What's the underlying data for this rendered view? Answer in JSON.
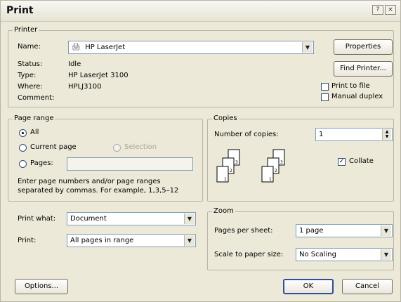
{
  "window": {
    "title": "Print",
    "title_buttons": [
      "?",
      "×"
    ]
  },
  "printer": {
    "group_label": "Printer",
    "name_label": "Name:",
    "name_value": "HP LaserJet",
    "status_label": "Status:",
    "status_value": "Idle",
    "type_label": "Type:",
    "type_value": "HP LaserJet 3100",
    "where_label": "Where:",
    "where_value": "HPLJ3100",
    "comment_label": "Comment:",
    "properties_button": "Properties",
    "find_printer_button": "Find Printer...",
    "print_to_file": {
      "label": "Print to file",
      "checked": false
    },
    "manual_duplex": {
      "label": "Manual duplex",
      "checked": false
    }
  },
  "page_range": {
    "group_label": "Page range",
    "all": "All",
    "current_page": "Current page",
    "selection": "Selection",
    "pages": "Pages:",
    "pages_value": "",
    "selected": "All",
    "help_text_1": "Enter page numbers and/or page ranges",
    "help_text_2": "separated by commas.  For example, 1,3,5–12"
  },
  "copies": {
    "group_label": "Copies",
    "number_label": "Number of copies:",
    "number_value": "1",
    "collate": {
      "label": "Collate",
      "checked": true
    }
  },
  "print_what": {
    "label": "Print what:",
    "value": "Document"
  },
  "print": {
    "label": "Print:",
    "value": "All pages in range"
  },
  "zoom": {
    "group_label": "Zoom",
    "pages_per_sheet_label": "Pages per sheet:",
    "pages_per_sheet_value": "1 page",
    "scale_label": "Scale to paper size:",
    "scale_value": "No Scaling"
  },
  "footer": {
    "options_button": "Options...",
    "ok_button": "OK",
    "cancel_button": "Cancel"
  },
  "colors": {
    "dialog_bg": "#ece9d8",
    "accent_blue": "#2f4f9d"
  }
}
